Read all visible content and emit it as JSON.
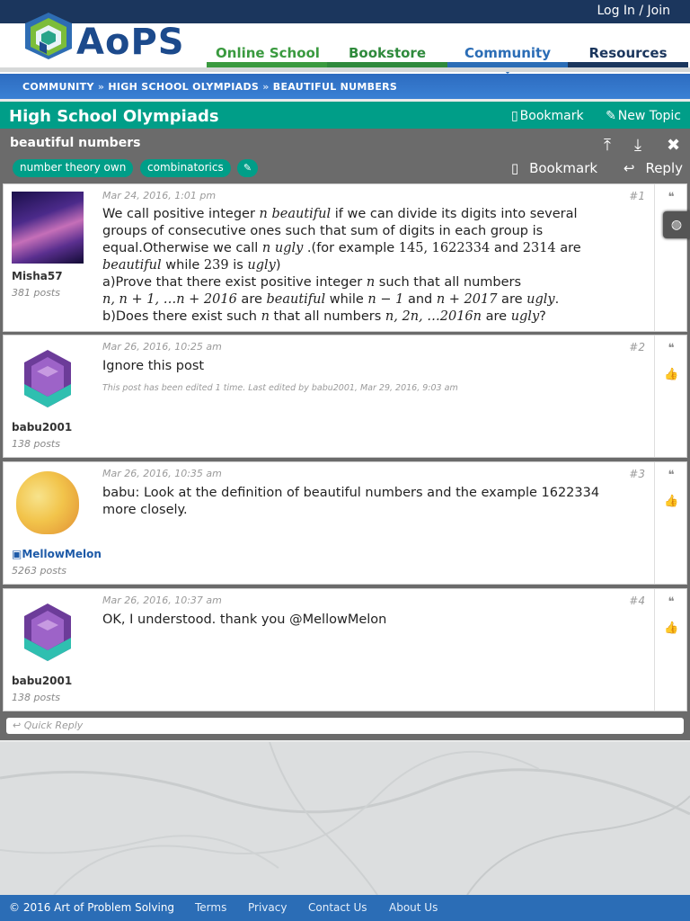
{
  "topbar": {
    "login": "Log In / Join"
  },
  "brand": {
    "name": "AoPS"
  },
  "nav": {
    "online_school": "Online School",
    "bookstore": "Bookstore",
    "community": "Community",
    "resources": "Resources"
  },
  "breadcrumb": {
    "community": "COMMUNITY",
    "forum": "HIGH SCHOOL OLYMPIADS",
    "topic": "BEAUTIFUL NUMBERS",
    "separator": "»"
  },
  "forum": {
    "title": "High School Olympiads",
    "bookmark": "Bookmark",
    "new_topic": "New Topic"
  },
  "topic": {
    "title": "beautiful numbers",
    "tags": [
      "number theory own",
      "combinatorics"
    ],
    "bookmark": "Bookmark",
    "reply": "Reply"
  },
  "posts": [
    {
      "author": "Misha57",
      "postcount": "381 posts",
      "date": "Mar 24, 2016, 1:01 pm",
      "number": "#1"
    },
    {
      "author": "babu2001",
      "postcount": "138 posts",
      "date": "Mar 26, 2016, 10:25 am",
      "number": "#2",
      "body": "Ignore this post",
      "edited": "This post has been edited 1 time. Last edited by babu2001, Mar 29, 2016, 9:03 am"
    },
    {
      "author": "MellowMelon",
      "postcount": "5263 posts",
      "date": "Mar 26, 2016, 10:35 am",
      "number": "#3",
      "body_line1": "babu: Look at the definition of beautiful numbers and the example 1622334",
      "body_line2": "more closely."
    },
    {
      "author": "babu2001",
      "postcount": "138 posts",
      "date": "Mar 26, 2016, 10:37 am",
      "number": "#4",
      "body": "OK, I understood. thank you @MellowMelon"
    }
  ],
  "post1": {
    "l1_a": "We call positive integer ",
    "l1_n": "n",
    "l1_beautiful": "beautiful",
    "l1_b": " if we can divide its digits into several",
    "l2": "groups of consecutive ones such that sum of digits in each group is",
    "l3_a": "equal.Otherwise we call ",
    "l3_n": "n",
    "l3_ugly": "ugly",
    "l3_b": " .(for example ",
    "l3_nums": "145, 1622334",
    "l3_and": " and ",
    "l3_num2": "2314",
    "l3_are": " are",
    "l4_beautiful": "beautiful",
    "l4_while": " while ",
    "l4_num": "239",
    "l4_is": " is ",
    "l4_ugly": "ugly",
    "l4_close": ")",
    "l5_a": "a)Prove that there exist positive integer ",
    "l5_n": "n",
    "l5_b": " such that all numbers",
    "l6_expr": "n, n + 1, …n + 2016",
    "l6_are": " are ",
    "l6_beautiful": "beautiful",
    "l6_while": " while ",
    "l6_e1": "n − 1",
    "l6_and": " and ",
    "l6_e2": "n + 2017",
    "l6_are2": " are ",
    "l6_ugly": "ugly",
    "l6_dot": ".",
    "l7_a": "b)Does there exist such ",
    "l7_n": "n",
    "l7_b": " that all numbers ",
    "l7_expr": "n, 2n, …2016n",
    "l7_are": " are ",
    "l7_ugly": "ugly",
    "l7_q": "?"
  },
  "quick_reply": "Quick Reply",
  "footer": {
    "copyright": "© 2016 Art of Problem Solving",
    "terms": "Terms",
    "privacy": "Privacy",
    "contact": "Contact Us",
    "about": "About Us"
  },
  "colors": {
    "navy": "#1b365d",
    "teal": "#009e88",
    "blue": "#2b6db6",
    "green_nav": "#3a9a3f",
    "orange_nav": "#e58d1f"
  },
  "icons": {
    "bookmark": "bookmark-icon",
    "new_topic": "edit-icon",
    "reply": "reply-icon",
    "quote": "quote-icon",
    "like": "thumbs-up-icon",
    "globe": "globe-icon"
  }
}
